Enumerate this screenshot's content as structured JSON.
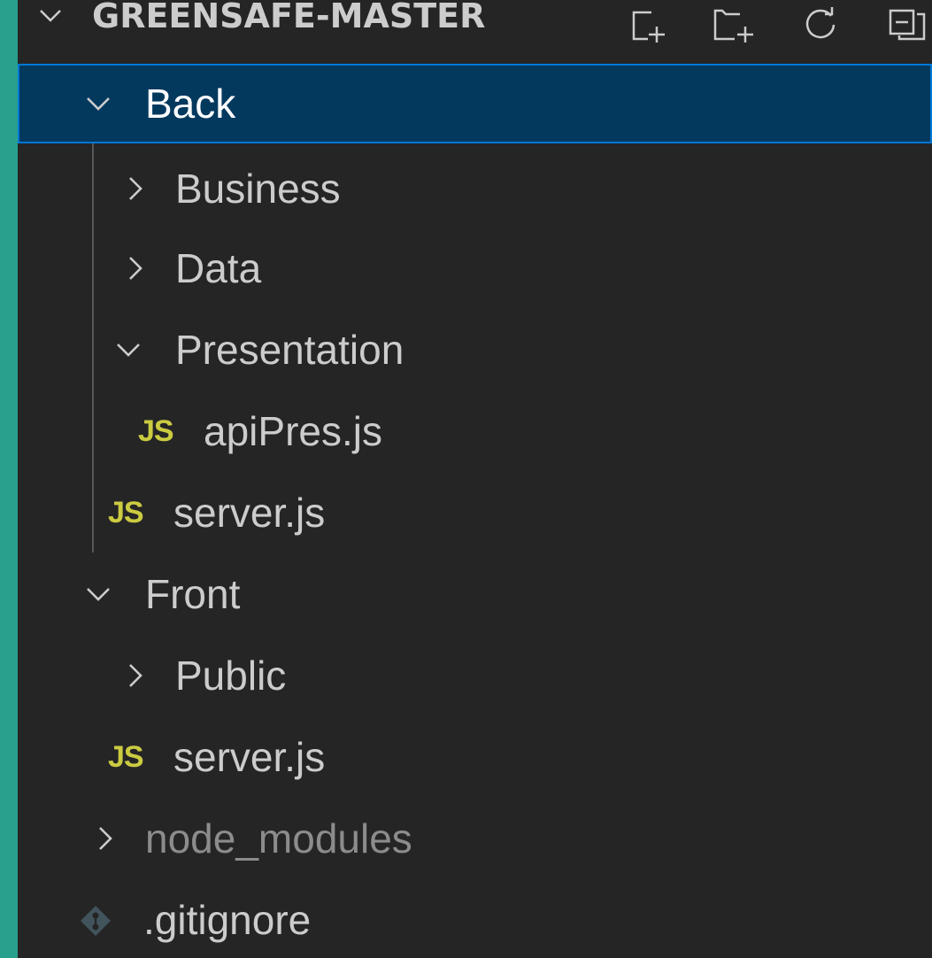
{
  "explorer": {
    "title": "GREENSAFE-MASTER",
    "actions": [
      {
        "icon": "new-file-icon"
      },
      {
        "icon": "new-folder-icon"
      },
      {
        "icon": "refresh-icon"
      },
      {
        "icon": "collapse-all-icon"
      }
    ]
  },
  "tree": {
    "back": "Back",
    "business": "Business",
    "data": "Data",
    "presentation": "Presentation",
    "api_pres": "apiPres.js",
    "back_server": "server.js",
    "front": "Front",
    "public": "Public",
    "front_server": "server.js",
    "node_modules": "node_modules",
    "gitignore": ".gitignore"
  },
  "badges": {
    "js": "JS"
  },
  "colors": {
    "frame": "#29a08e",
    "panel": "#252526",
    "selected_bg": "#04395e",
    "selected_border": "#0078d4",
    "js_icon": "#cbcb41"
  }
}
